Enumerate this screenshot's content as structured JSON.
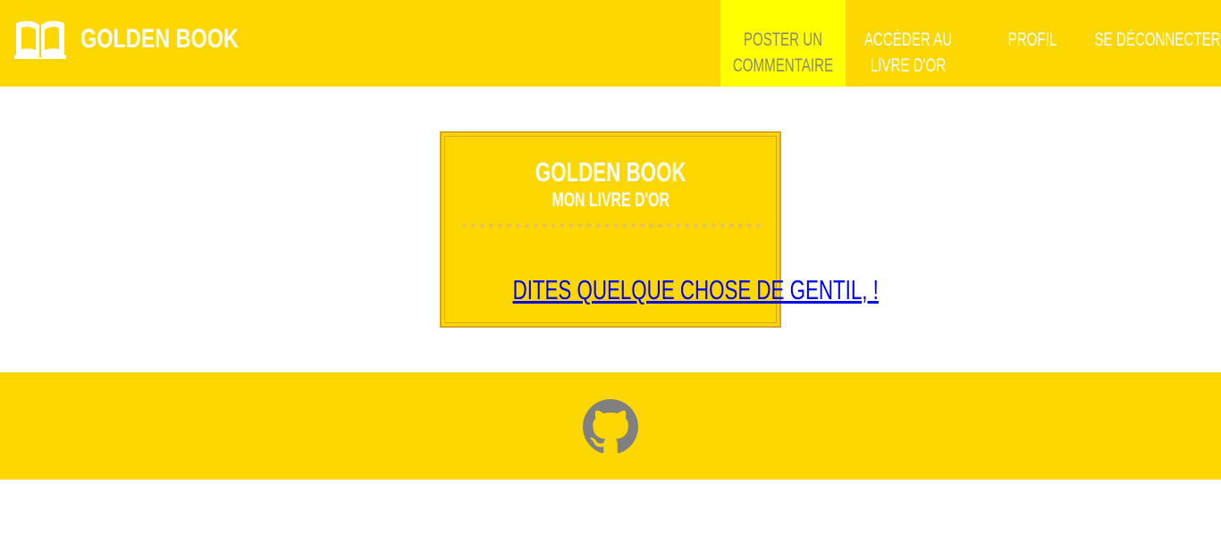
{
  "header": {
    "brand": {
      "icon": "open-book-icon",
      "label": "GOLDEN BOOK"
    },
    "nav": [
      {
        "label": "POSTER UN COMMENTAIRE",
        "active": true
      },
      {
        "label": "ACCÉDER AU LIVRE D'OR",
        "active": false
      },
      {
        "label": "PROFIL",
        "active": false
      },
      {
        "label": "SE DÉCONNECTER",
        "active": false
      }
    ]
  },
  "card": {
    "title": "GOLDEN BOOK",
    "subtitle": "MON LIVRE D'OR",
    "link_label": "DITES QUELQUE CHOSE DE GENTIL, !"
  },
  "footer": {
    "github_icon": "github-icon"
  },
  "colors": {
    "primary_yellow": "#FFD700",
    "active_nav": "#FFFF00",
    "card_border": "#DAA520",
    "link_blue": "#0000EE",
    "github_gray": "#808080"
  }
}
